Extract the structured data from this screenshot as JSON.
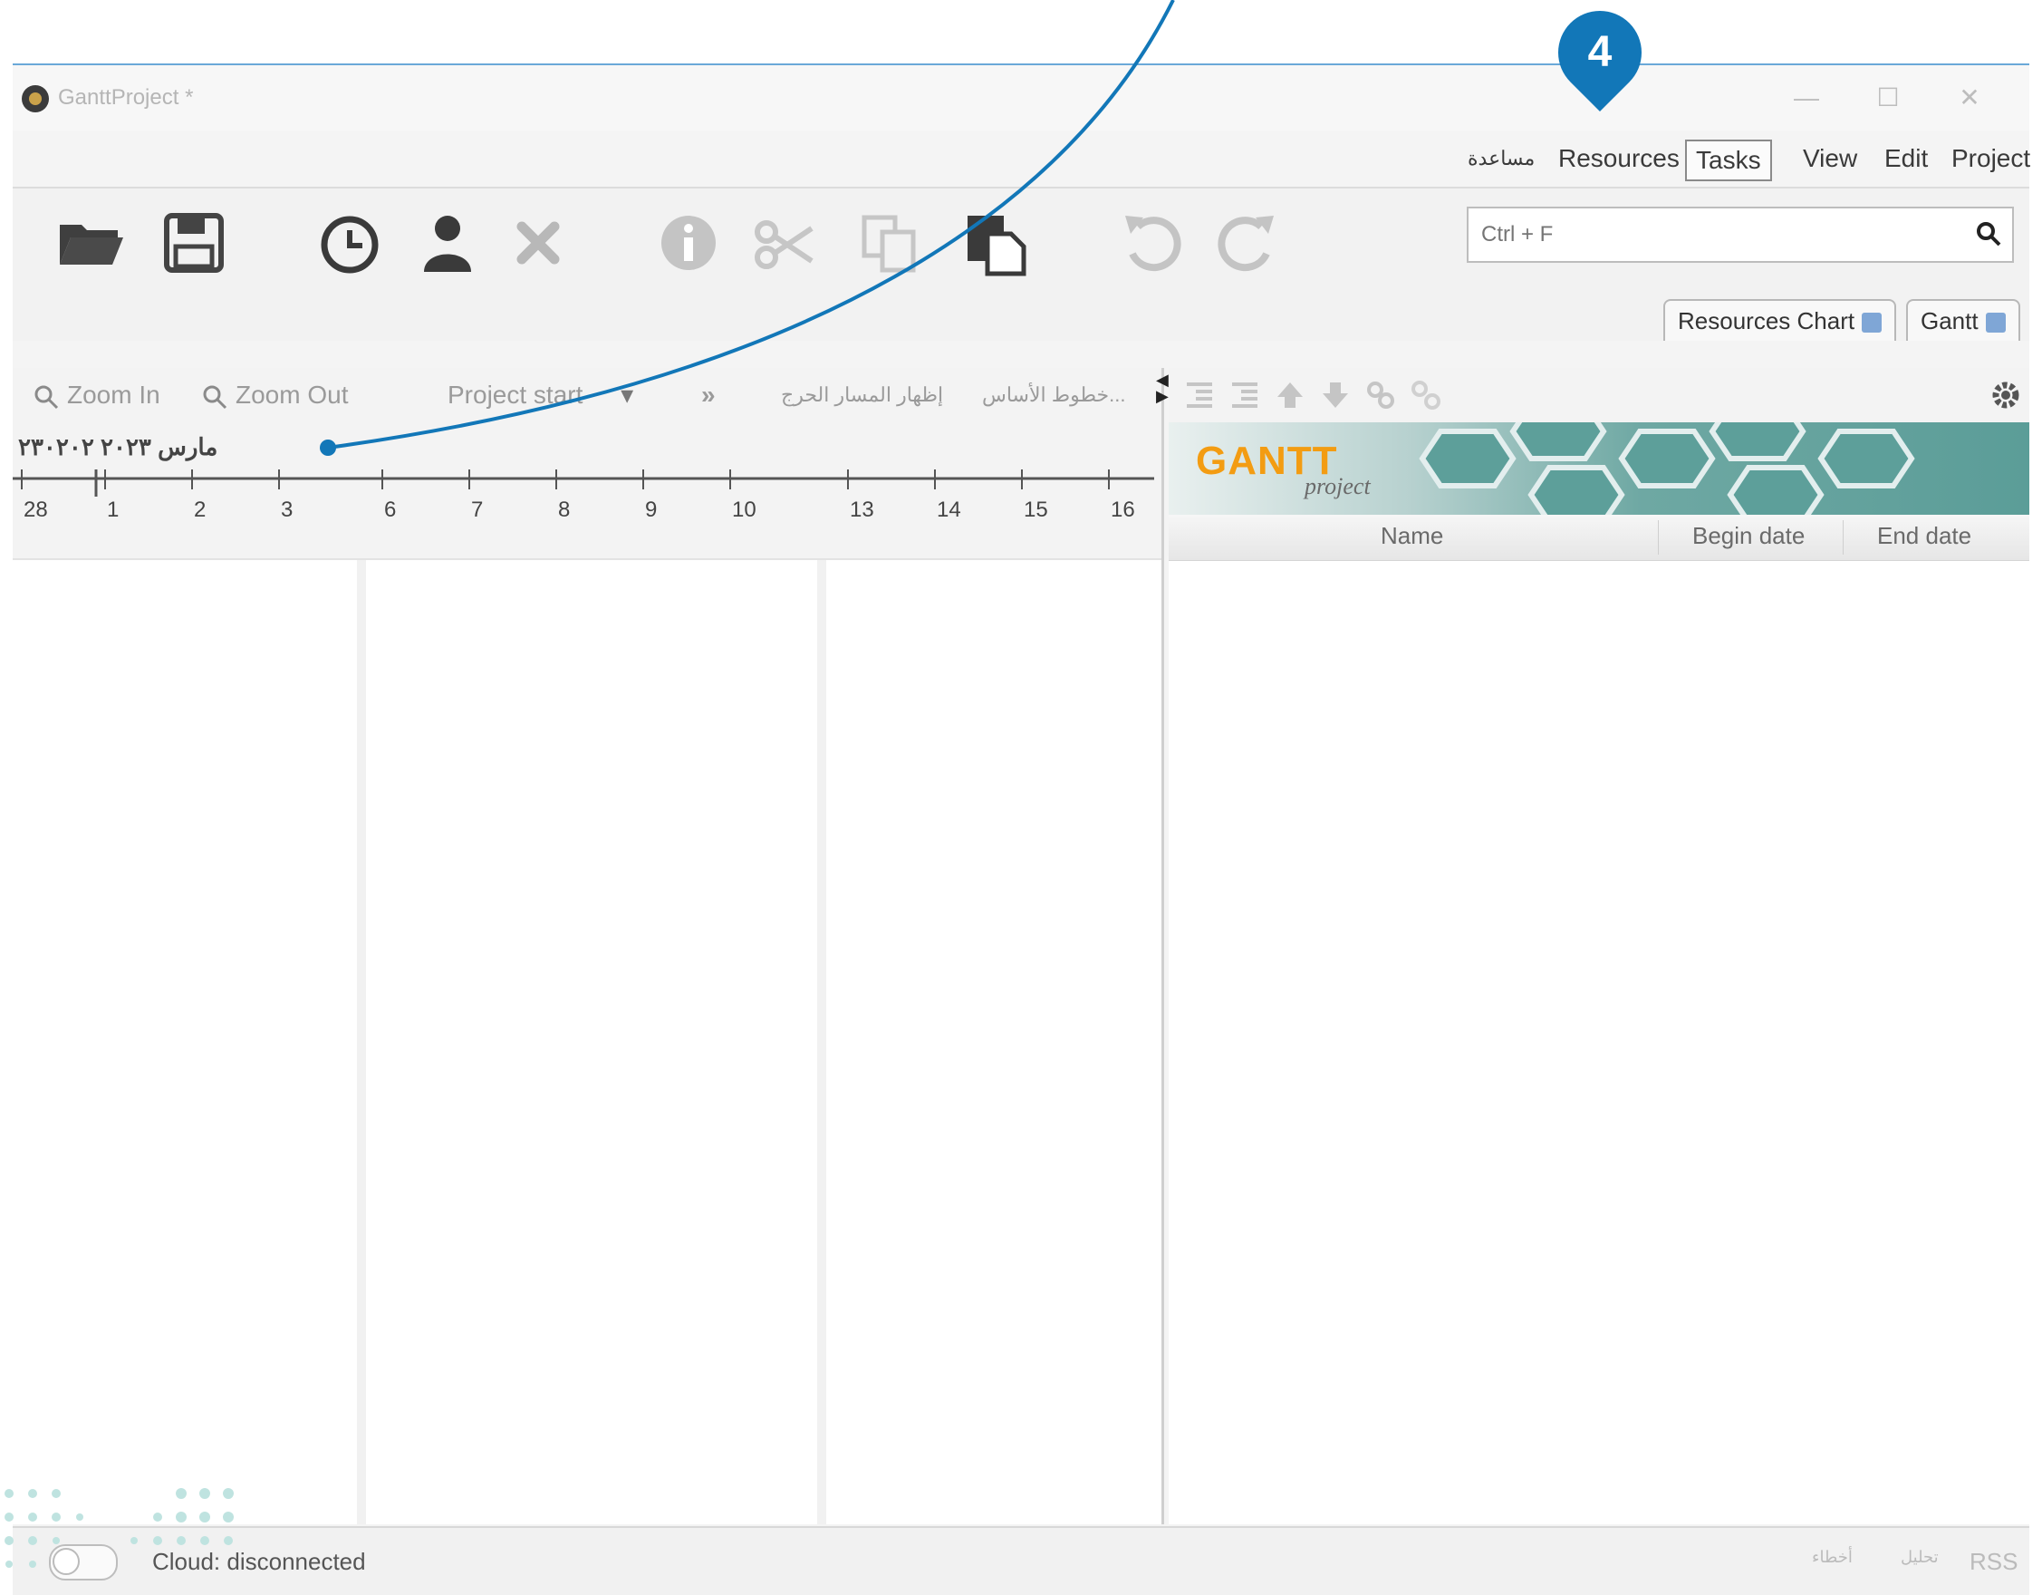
{
  "callout": {
    "number": "4",
    "color": "#1277b8"
  },
  "window": {
    "title": "GanttProject *",
    "controls": {
      "minimize": "—",
      "maximize": "☐",
      "close": "✕"
    }
  },
  "menu": {
    "items": [
      {
        "label": "مساعدة",
        "active": false
      },
      {
        "label": "Resources",
        "active": false
      },
      {
        "label": "Tasks",
        "active": true
      },
      {
        "label": "View",
        "active": false
      },
      {
        "label": "Edit",
        "active": false
      },
      {
        "label": "Project",
        "active": false
      }
    ]
  },
  "toolbar": {
    "icons": [
      "open-folder-icon",
      "save-icon",
      "clock-icon",
      "person-icon",
      "delete-icon",
      "info-icon",
      "cut-icon",
      "copy-icon",
      "paste-icon",
      "undo-icon",
      "redo-icon"
    ],
    "search_placeholder": "Ctrl + F"
  },
  "view_tabs": {
    "resources_chart": "Resources Chart",
    "gantt": "Gantt"
  },
  "chart_toolbar": {
    "zoom_in": "Zoom In",
    "zoom_out": "Zoom Out",
    "project_start": "Project start",
    "arrows": "»",
    "critical_path": "إظهار المسار الحرج",
    "baseline": "خطوط الأساس..."
  },
  "timeline": {
    "month_label": "مارس ٢٠٢٣  ٢٣٠٢٠٢",
    "days": [
      "28",
      "1",
      "2",
      "3",
      "6",
      "7",
      "8",
      "9",
      "10",
      "13",
      "14",
      "15",
      "16"
    ]
  },
  "task_table": {
    "logo_text": "GANTT",
    "logo_sub": "project",
    "columns": {
      "name": "Name",
      "begin_date": "Begin date",
      "end_date": "End date"
    }
  },
  "status": {
    "cloud": "Cloud: disconnected",
    "right_items": [
      "أخطاء",
      "تحليل",
      "RSS"
    ]
  }
}
